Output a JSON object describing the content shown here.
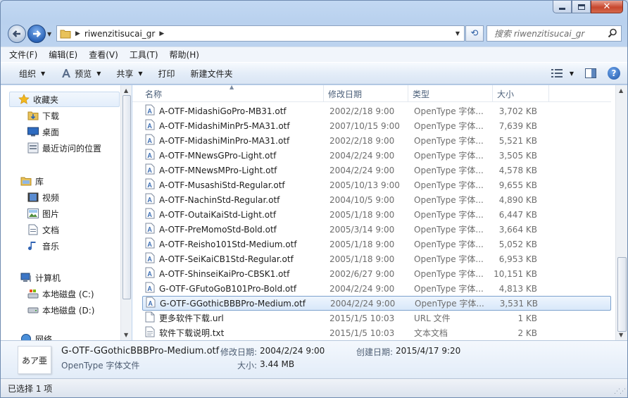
{
  "window": {
    "accent": "#c2d8f2"
  },
  "address": {
    "crumb": "riwenzitisucai_gr"
  },
  "search": {
    "placeholder": "搜索 riwenzitisucai_gr"
  },
  "menu": [
    "文件(F)",
    "编辑(E)",
    "查看(V)",
    "工具(T)",
    "帮助(H)"
  ],
  "commands": {
    "organize": "组织",
    "preview": "预览",
    "share": "共享",
    "print": "打印",
    "new_folder": "新建文件夹"
  },
  "navpane": {
    "favorites": "收藏夹",
    "downloads": "下载",
    "desktop": "桌面",
    "recent": "最近访问的位置",
    "libraries": "库",
    "videos": "视频",
    "pictures": "图片",
    "documents": "文档",
    "music": "音乐",
    "computer": "计算机",
    "drive_c": "本地磁盘 (C:)",
    "drive_d": "本地磁盘 (D:)",
    "network": "网络"
  },
  "columns": {
    "name": "名称",
    "date": "修改日期",
    "type": "类型",
    "size": "大小"
  },
  "files": [
    {
      "name": "A-OTF-MidashiGoPro-MB31.otf",
      "date": "2002/2/18 9:00",
      "type": "OpenType 字体...",
      "size": "3,702 KB",
      "icon": "font-icon"
    },
    {
      "name": "A-OTF-MidashiMinPr5-MA31.otf",
      "date": "2007/10/15 9:00",
      "type": "OpenType 字体...",
      "size": "7,639 KB",
      "icon": "font-icon"
    },
    {
      "name": "A-OTF-MidashiMinPro-MA31.otf",
      "date": "2002/2/18 9:00",
      "type": "OpenType 字体...",
      "size": "5,521 KB",
      "icon": "font-icon"
    },
    {
      "name": "A-OTF-MNewsGPro-Light.otf",
      "date": "2004/2/24 9:00",
      "type": "OpenType 字体...",
      "size": "3,505 KB",
      "icon": "font-icon"
    },
    {
      "name": "A-OTF-MNewsMPro-Light.otf",
      "date": "2004/2/24 9:00",
      "type": "OpenType 字体...",
      "size": "4,578 KB",
      "icon": "font-icon"
    },
    {
      "name": "A-OTF-MusashiStd-Regular.otf",
      "date": "2005/10/13 9:00",
      "type": "OpenType 字体...",
      "size": "9,655 KB",
      "icon": "font-icon"
    },
    {
      "name": "A-OTF-NachinStd-Regular.otf",
      "date": "2004/10/5 9:00",
      "type": "OpenType 字体...",
      "size": "4,890 KB",
      "icon": "font-icon"
    },
    {
      "name": "A-OTF-OutaiKaiStd-Light.otf",
      "date": "2005/1/18 9:00",
      "type": "OpenType 字体...",
      "size": "6,447 KB",
      "icon": "font-icon"
    },
    {
      "name": "A-OTF-PreMomoStd-Bold.otf",
      "date": "2005/3/14 9:00",
      "type": "OpenType 字体...",
      "size": "3,664 KB",
      "icon": "font-icon"
    },
    {
      "name": "A-OTF-Reisho101Std-Medium.otf",
      "date": "2005/1/18 9:00",
      "type": "OpenType 字体...",
      "size": "5,052 KB",
      "icon": "font-icon"
    },
    {
      "name": "A-OTF-SeiKaiCB1Std-Regular.otf",
      "date": "2005/1/18 9:00",
      "type": "OpenType 字体...",
      "size": "6,953 KB",
      "icon": "font-icon"
    },
    {
      "name": "A-OTF-ShinseiKaiPro-CBSK1.otf",
      "date": "2002/6/27 9:00",
      "type": "OpenType 字体...",
      "size": "10,151 KB",
      "icon": "font-icon"
    },
    {
      "name": "G-OTF-GFutoGoB101Pro-Bold.otf",
      "date": "2004/2/24 9:00",
      "type": "OpenType 字体...",
      "size": "4,813 KB",
      "icon": "font-icon"
    },
    {
      "name": "G-OTF-GGothicBBBPro-Medium.otf",
      "date": "2004/2/24 9:00",
      "type": "OpenType 字体...",
      "size": "3,531 KB",
      "icon": "font-icon",
      "selected": true
    },
    {
      "name": "更多软件下载.url",
      "date": "2015/1/5 10:03",
      "type": "URL 文件",
      "size": "1 KB",
      "icon": "url-file-icon"
    },
    {
      "name": "软件下载说明.txt",
      "date": "2015/1/5 10:03",
      "type": "文本文档",
      "size": "2 KB",
      "icon": "text-file-icon"
    }
  ],
  "details": {
    "thumb_text": "あア亜",
    "name": "G-OTF-GGothicBBBPro-Medium.otf",
    "type": "OpenType 字体文件",
    "modified_label": "修改日期:",
    "modified": "2004/2/24 9:00",
    "created_label": "创建日期:",
    "created": "2015/4/17 9:20",
    "size_label": "大小:",
    "size": "3.44 MB"
  },
  "status": {
    "text": "已选择 1 项"
  }
}
